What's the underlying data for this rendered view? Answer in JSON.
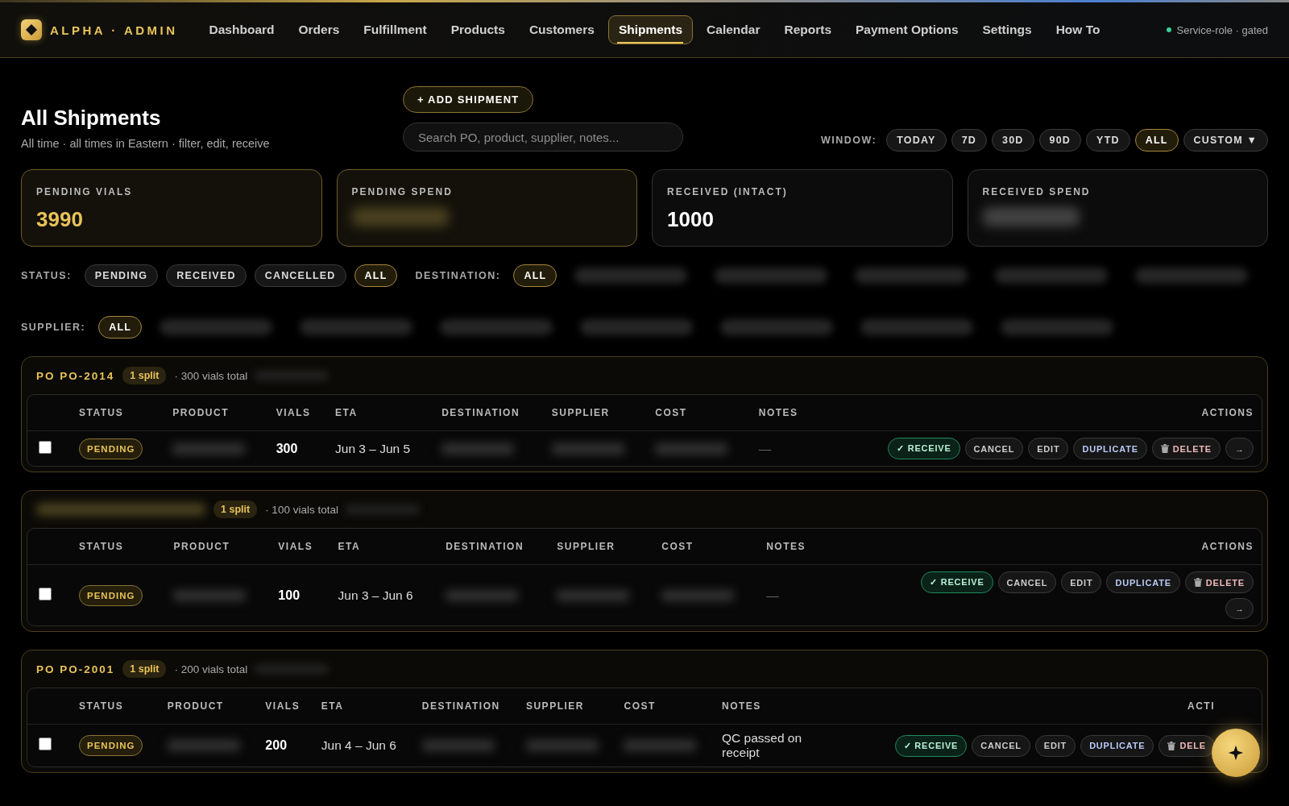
{
  "brand": {
    "name": "ALPHA · ADMIN"
  },
  "nav": {
    "items": [
      {
        "label": "Dashboard",
        "selected": false
      },
      {
        "label": "Orders",
        "selected": false
      },
      {
        "label": "Fulfillment",
        "selected": false
      },
      {
        "label": "Products",
        "selected": false
      },
      {
        "label": "Customers",
        "selected": false
      },
      {
        "label": "Shipments",
        "selected": true
      },
      {
        "label": "Calendar",
        "selected": false
      },
      {
        "label": "Reports",
        "selected": false
      },
      {
        "label": "Payment Options",
        "selected": false
      },
      {
        "label": "Settings",
        "selected": false
      },
      {
        "label": "How To",
        "selected": false
      }
    ],
    "status": "Service-role · gated"
  },
  "page": {
    "title": "All Shipments",
    "subtitle": "All time · all times in Eastern · filter, edit, receive",
    "add_button": "+ ADD SHIPMENT",
    "search": {
      "placeholder": "Search PO, product, supplier, notes..."
    }
  },
  "window_filter": {
    "label": "WINDOW:",
    "options": [
      {
        "label": "TODAY",
        "selected": false
      },
      {
        "label": "7D",
        "selected": false
      },
      {
        "label": "30D",
        "selected": false
      },
      {
        "label": "90D",
        "selected": false
      },
      {
        "label": "YTD",
        "selected": false
      },
      {
        "label": "ALL",
        "selected": true
      },
      {
        "label": "CUSTOM ▼",
        "selected": false
      }
    ]
  },
  "stats": [
    {
      "label": "PENDING VIALS",
      "kind": "gold",
      "value": "3990"
    },
    {
      "label": "PENDING SPEND",
      "kind": "gold",
      "redacted": true
    },
    {
      "label": "RECEIVED (INTACT)",
      "kind": "plain",
      "value": "1000"
    },
    {
      "label": "RECEIVED SPEND",
      "kind": "plain",
      "redacted": true
    }
  ],
  "filters": [
    {
      "label": "STATUS:",
      "options": [
        {
          "kind": "text",
          "label": "PENDING",
          "selected": false
        },
        {
          "kind": "text",
          "label": "RECEIVED",
          "selected": false
        },
        {
          "kind": "text",
          "label": "CANCELLED",
          "selected": false
        },
        {
          "kind": "text",
          "label": "ALL",
          "selected": true
        }
      ]
    },
    {
      "label": "DESTINATION:",
      "options": [
        {
          "kind": "text",
          "label": "ALL",
          "selected": true
        },
        {
          "kind": "redacted"
        },
        {
          "kind": "redacted"
        },
        {
          "kind": "redacted"
        },
        {
          "kind": "redacted"
        },
        {
          "kind": "redacted"
        }
      ]
    },
    {
      "label": "SUPPLIER:",
      "options": [
        {
          "kind": "text",
          "label": "ALL",
          "selected": true
        },
        {
          "kind": "redacted"
        },
        {
          "kind": "redacted"
        },
        {
          "kind": "redacted"
        },
        {
          "kind": "redacted"
        },
        {
          "kind": "redacted"
        },
        {
          "kind": "redacted"
        },
        {
          "kind": "redacted"
        }
      ]
    }
  ],
  "groups": [
    {
      "po": "PO PO-2014",
      "split": "1 split",
      "total": "· 300 vials total",
      "columns": [
        "STATUS",
        "PRODUCT",
        "VIALS",
        "ETA",
        "DESTINATION",
        "SUPPLIER",
        "COST",
        "NOTES",
        "ACTIONS"
      ],
      "rows": [
        {
          "checked": false,
          "cells": [
            {
              "kind": "status",
              "text": "PENDING"
            },
            {
              "kind": "redacted"
            },
            {
              "kind": "number",
              "text": "300"
            },
            {
              "kind": "text",
              "text": "Jun 3 – Jun 5"
            },
            {
              "kind": "redacted"
            },
            {
              "kind": "redacted"
            },
            {
              "kind": "redacted"
            },
            {
              "kind": "muted",
              "text": "—"
            }
          ],
          "actions": [
            {
              "kind": "receive",
              "label": "✓ RECEIVE"
            },
            {
              "kind": "plain",
              "label": "CANCEL"
            },
            {
              "kind": "plain",
              "label": "EDIT"
            },
            {
              "kind": "duplicate",
              "label": "DUPLICATE"
            },
            {
              "kind": "delete",
              "label": "DELETE"
            },
            {
              "kind": "arrow",
              "label": "→"
            }
          ]
        }
      ]
    },
    {
      "split": "1 split",
      "total": "· 100 vials total",
      "columns": [
        "STATUS",
        "PRODUCT",
        "VIALS",
        "ETA",
        "DESTINATION",
        "SUPPLIER",
        "COST",
        "NOTES",
        "ACTIONS"
      ],
      "rows": [
        {
          "checked": false,
          "cells": [
            {
              "kind": "status",
              "text": "PENDING"
            },
            {
              "kind": "redacted"
            },
            {
              "kind": "number",
              "text": "100"
            },
            {
              "kind": "text",
              "text": "Jun 3 – Jun 6"
            },
            {
              "kind": "redacted"
            },
            {
              "kind": "redacted"
            },
            {
              "kind": "redacted"
            },
            {
              "kind": "muted",
              "text": "—"
            }
          ],
          "actions": [
            {
              "kind": "receive",
              "label": "✓ RECEIVE"
            },
            {
              "kind": "plain",
              "label": "CANCEL"
            },
            {
              "kind": "plain",
              "label": "EDIT"
            },
            {
              "kind": "duplicate",
              "label": "DUPLICATE"
            },
            {
              "kind": "delete",
              "label": "DELETE"
            },
            {
              "kind": "arrow",
              "label": "→"
            }
          ]
        }
      ]
    },
    {
      "po": "PO PO-2001",
      "split": "1 split",
      "total": "· 200 vials total",
      "columns": [
        "STATUS",
        "PRODUCT",
        "VIALS",
        "ETA",
        "DESTINATION",
        "SUPPLIER",
        "COST",
        "NOTES",
        "ACTI"
      ],
      "rows": [
        {
          "checked": false,
          "cells": [
            {
              "kind": "status",
              "text": "PENDING"
            },
            {
              "kind": "redacted"
            },
            {
              "kind": "number",
              "text": "200"
            },
            {
              "kind": "text",
              "text": "Jun 4 – Jun 6"
            },
            {
              "kind": "redacted"
            },
            {
              "kind": "redacted"
            },
            {
              "kind": "redacted"
            },
            {
              "kind": "text",
              "text": "QC passed on receipt"
            }
          ],
          "actions": [
            {
              "kind": "receive",
              "label": "✓ RECEIVE"
            },
            {
              "kind": "plain",
              "label": "CANCEL"
            },
            {
              "kind": "plain",
              "label": "EDIT"
            },
            {
              "kind": "duplicate",
              "label": "DUPLICATE"
            },
            {
              "kind": "delete",
              "label": "DELE"
            }
          ]
        }
      ]
    }
  ]
}
